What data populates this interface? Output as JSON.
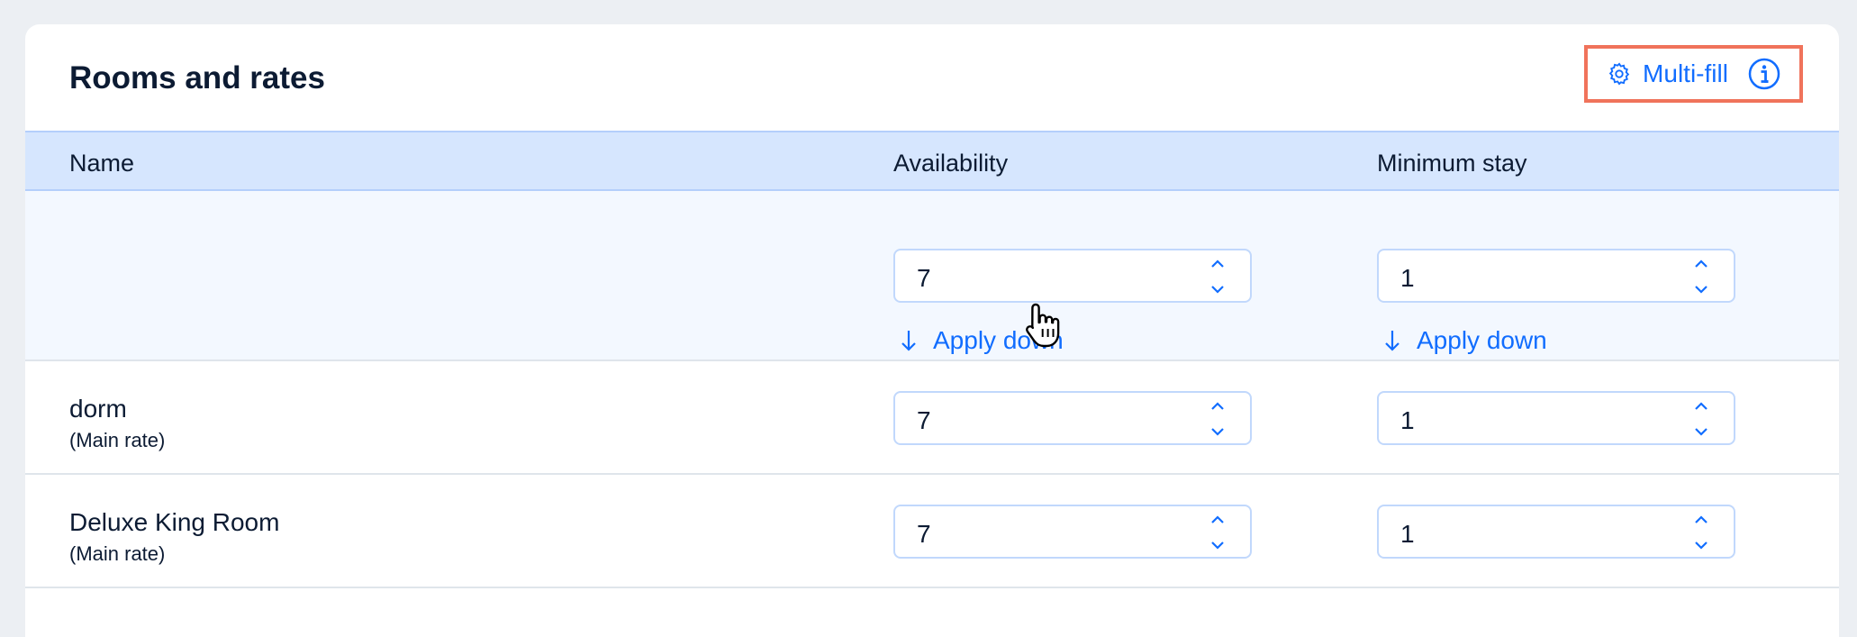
{
  "header": {
    "title": "Rooms and rates",
    "multifill_label": "Multi-fill"
  },
  "table": {
    "columns": [
      "Name",
      "Availability",
      "Minimum stay"
    ],
    "fill_row": {
      "availability": "7",
      "minimum_stay": "1",
      "apply_label": "Apply down"
    },
    "rows": [
      {
        "name": "dorm",
        "rate": "(Main rate)",
        "availability": "7",
        "minimum_stay": "1"
      },
      {
        "name": "Deluxe King Room",
        "rate": "(Main rate)",
        "availability": "7",
        "minimum_stay": "1"
      }
    ]
  },
  "colors": {
    "accent": "#116DFF",
    "highlight_border": "#F0735B",
    "header_bg": "#D6E6FE"
  },
  "icons": [
    "gear-icon",
    "info-icon",
    "chevron-up-down-icon",
    "arrow-down-icon",
    "hand-pointer-icon"
  ]
}
